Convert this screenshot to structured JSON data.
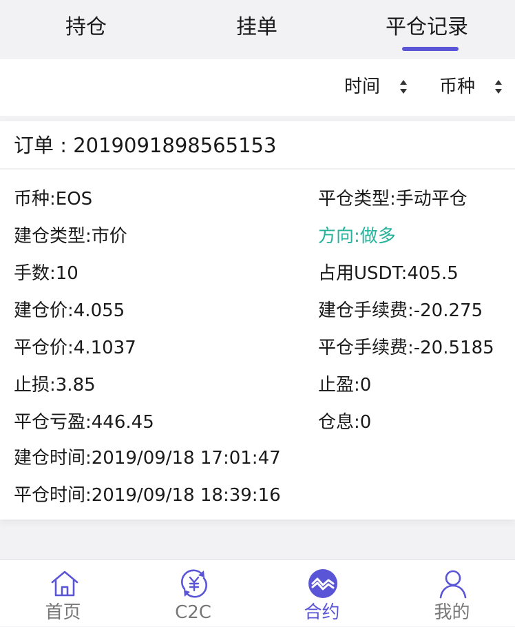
{
  "tabs": [
    "持仓",
    "挂单",
    "平仓记录"
  ],
  "active_tab_index": 2,
  "sort": {
    "time_label": "时间",
    "coin_label": "币种"
  },
  "order": {
    "label": "订单 : 2019091898565153"
  },
  "fields_left": [
    "币种:EOS",
    "建仓类型:市价",
    "手数:10",
    "建仓价:4.055",
    "平仓价:4.1037",
    "止损:3.85",
    "平仓亏盈:446.45",
    "建仓时间:2019/09/18 17:01:47",
    "平仓时间:2019/09/18 18:39:16"
  ],
  "fields_right": [
    "平仓类型:手动平仓",
    "方向:做多",
    "占用USDT:405.5",
    "建仓手续费:-20.275",
    "平仓手续费:-20.5185",
    "止盈:0",
    "仓息:0"
  ],
  "nav": [
    {
      "label": "首页",
      "icon": "home-icon"
    },
    {
      "label": "C2C",
      "icon": "c2c-exchange-icon"
    },
    {
      "label": "合约",
      "icon": "contract-icon"
    },
    {
      "label": "我的",
      "icon": "user-icon"
    }
  ],
  "colors": {
    "accent": "#5a55d6",
    "long_green": "#27b29b",
    "nav_inactive": "#777777"
  }
}
